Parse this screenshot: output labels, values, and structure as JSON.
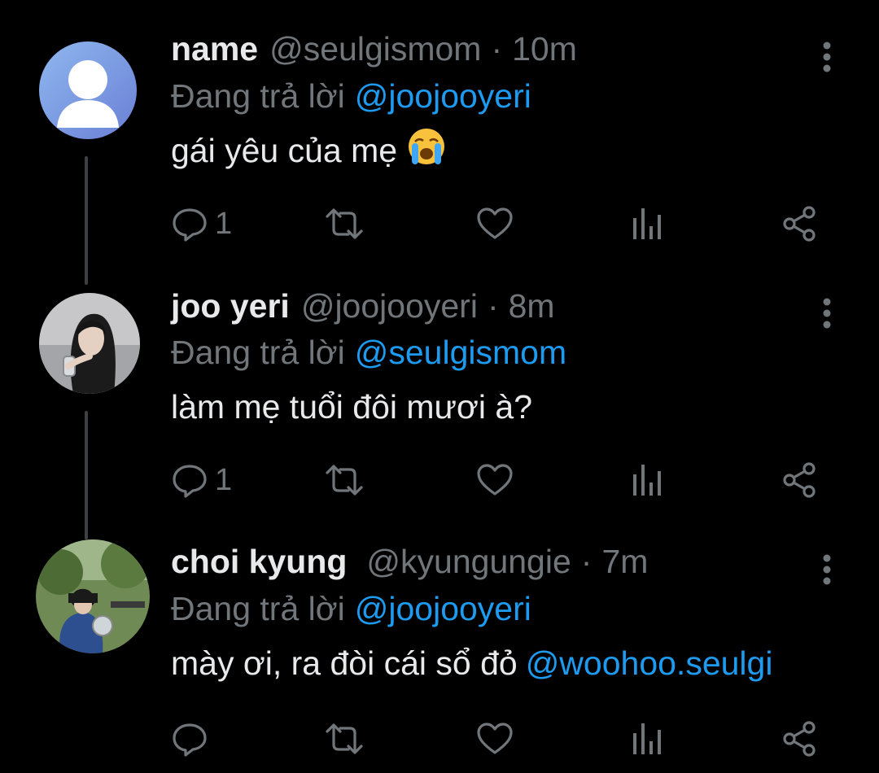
{
  "thread": [
    {
      "display_name": "name",
      "handle": "@seulgismom",
      "separator": "·",
      "time": "10m",
      "reply_label": "Đang trả lời",
      "reply_to": "@joojooyeri",
      "text": "gái yêu của mẹ",
      "emoji": "loudly-crying-face",
      "reply_count": "1",
      "avatar": "default-avatar"
    },
    {
      "display_name": "joo yeri",
      "handle": "@joojooyeri",
      "separator": "·",
      "time": "8m",
      "reply_label": "Đang trả lời",
      "reply_to": "@seulgismom",
      "text": "làm mẹ tuổi đôi mươi à?",
      "reply_count": "1",
      "avatar": "photo-avatar"
    },
    {
      "display_name": "choi kyung",
      "handle": "@kyungungie",
      "separator": "·",
      "time": "7m",
      "reply_label": "Đang trả lời",
      "reply_to": "@joojooyeri",
      "text": "mày ơi, ra đòi cái sổ đỏ",
      "text_mention": "@woohoo.seulgi",
      "reply_count": "",
      "avatar": "photo-avatar"
    }
  ],
  "colors": {
    "background": "#000000",
    "primary_text": "#e7e9ea",
    "secondary_text": "#71767b",
    "link": "#1d9bf0",
    "thread_line": "#3e4144"
  },
  "icons": [
    "reply-icon",
    "retweet-icon",
    "like-icon",
    "analytics-icon",
    "share-icon",
    "more-icon"
  ]
}
